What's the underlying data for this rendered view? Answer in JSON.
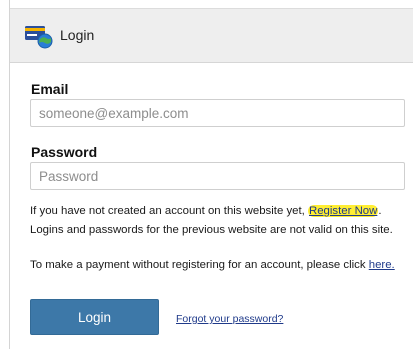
{
  "header": {
    "title": "Login",
    "icon": "login-card-globe-icon"
  },
  "form": {
    "email_label": "Email",
    "email_placeholder": "someone@example.com",
    "email_value": "",
    "password_label": "Password",
    "password_placeholder": "Password",
    "password_value": ""
  },
  "notes": {
    "register_prefix": "If you have not created an account on this website yet, ",
    "register_link": "Register Now",
    "register_suffix": ".",
    "previous_site": "Logins and passwords for the previous website are not valid on this site.",
    "payment_prefix": "To make a payment without registering for an account, please click ",
    "payment_link": "here.",
    "highlight_color": "#ffee33"
  },
  "actions": {
    "login_label": "Login",
    "forgot_label": "Forgot your password?",
    "button_color": "#3d78a8"
  }
}
